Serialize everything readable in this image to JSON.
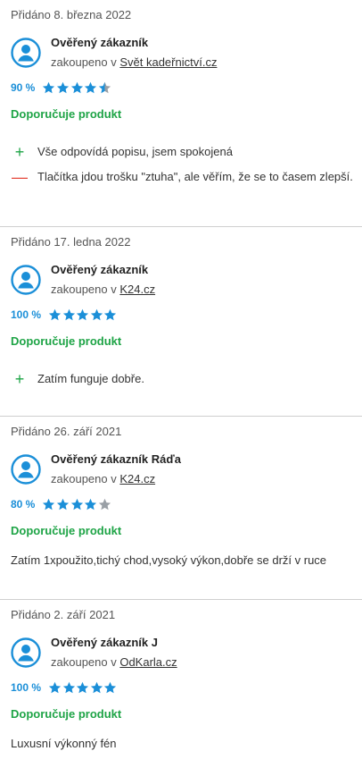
{
  "colors": {
    "accent_blue": "#1b8fd8",
    "recommend_green": "#1ea446",
    "minus_red": "#e5473a",
    "star_empty": "#9aa0a6"
  },
  "reviews": [
    {
      "date": "Přidáno 8. března 2022",
      "author": "Ověřený zákazník",
      "shop_prefix": "zakoupeno v ",
      "shop": "Svět kadeřnictví.cz",
      "percent": "90 %",
      "rating": 4.5,
      "recommend": "Doporučuje produkt",
      "pros": [
        "Vše odpovídá popisu, jsem spokojená"
      ],
      "cons": [
        "Tlačítka jdou trošku \"ztuha\", ale věřím, že se to časem zlepší."
      ],
      "comment": ""
    },
    {
      "date": "Přidáno 17. ledna 2022",
      "author": "Ověřený zákazník",
      "shop_prefix": "zakoupeno v ",
      "shop": "K24.cz",
      "percent": "100 %",
      "rating": 5,
      "recommend": "Doporučuje produkt",
      "pros": [
        "Zatím funguje dobře."
      ],
      "cons": [],
      "comment": ""
    },
    {
      "date": "Přidáno 26. září 2021",
      "author": "Ověřený zákazník Ráďa",
      "shop_prefix": "zakoupeno v ",
      "shop": "K24.cz",
      "percent": "80 %",
      "rating": 4,
      "recommend": "Doporučuje produkt",
      "pros": [],
      "cons": [],
      "comment": "Zatím 1xpoužito,tichý chod,vysoký výkon,dobře se drží v ruce"
    },
    {
      "date": "Přidáno 2. září 2021",
      "author": "Ověřený zákazník J",
      "shop_prefix": "zakoupeno v ",
      "shop": "OdKarla.cz",
      "percent": "100 %",
      "rating": 5,
      "recommend": "Doporučuje produkt",
      "pros": [],
      "cons": [],
      "comment": "Luxusní výkonný fén"
    }
  ]
}
